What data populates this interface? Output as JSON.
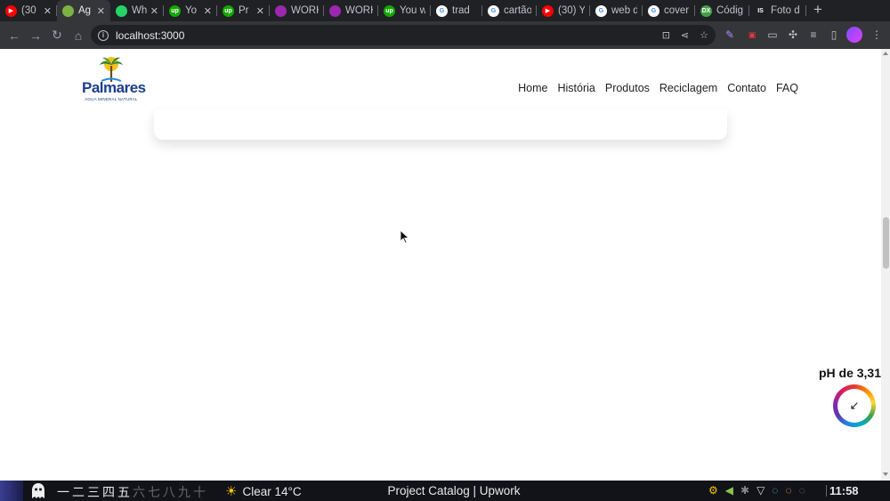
{
  "browser": {
    "tabs": [
      {
        "title": "(30",
        "favicon": "youtube-icon",
        "color": "#ff0000",
        "glyph": "▶",
        "width": 64
      },
      {
        "title": "Ag",
        "favicon": "palm-favicon-icon",
        "color": "#7cb342",
        "glyph": "",
        "width": 60,
        "active": true
      },
      {
        "title": "Wh",
        "favicon": "whatsapp-icon",
        "color": "#25d366",
        "glyph": "",
        "width": 60
      },
      {
        "title": "Yo",
        "favicon": "upwork-icon",
        "color": "#14a800",
        "glyph": "up",
        "width": 60
      },
      {
        "title": "Pr",
        "favicon": "upwork-icon",
        "color": "#14a800",
        "glyph": "up",
        "width": 59
      },
      {
        "title": "WORK",
        "favicon": "color-wheel-icon",
        "color": "#9c27b0",
        "glyph": "",
        "width": 61
      },
      {
        "title": "WORK",
        "favicon": "color-wheel-icon",
        "color": "#9c27b0",
        "glyph": "",
        "width": 61
      },
      {
        "title": "You w",
        "favicon": "upwork-icon",
        "color": "#14a800",
        "glyph": "up",
        "width": 59
      },
      {
        "title": "trad",
        "favicon": "google-icon",
        "color": "#ffffff",
        "glyph": "G",
        "width": 58
      },
      {
        "title": "cartão",
        "favicon": "google-icon",
        "color": "#ffffff",
        "glyph": "G",
        "width": 61
      },
      {
        "title": "(30) Y",
        "favicon": "youtube-icon",
        "color": "#ff0000",
        "glyph": "▶",
        "width": 60
      },
      {
        "title": "web d",
        "favicon": "google-icon",
        "color": "#ffffff",
        "glyph": "G",
        "width": 59
      },
      {
        "title": "cover",
        "favicon": "google-icon",
        "color": "#ffffff",
        "glyph": "G",
        "width": 59
      },
      {
        "title": "Códig",
        "favicon": "dx-icon",
        "color": "#43a047",
        "glyph": "DX",
        "width": 61
      },
      {
        "title": "Foto d",
        "favicon": "is-icon",
        "color": "#202124",
        "glyph": "IS",
        "width": 64
      }
    ],
    "url": "localhost:3000"
  },
  "site": {
    "logo_text": "Palmares",
    "logo_tagline": "ÁGUA MINERAL NATURAL",
    "nav": [
      "Home",
      "História",
      "Produtos",
      "Reciclagem",
      "Contato",
      "FAQ"
    ],
    "ph_label": "pH de 3,31",
    "ph_icon": "arrow-down-left-icon"
  },
  "taskbar": {
    "workspaces": [
      "一",
      "二",
      "三",
      "四",
      "五",
      "六",
      "七",
      "八",
      "九",
      "十"
    ],
    "active_workspaces": 5,
    "weather": "Clear 14°C",
    "window_title": "Project Catalog | Upwork",
    "clock": "11:58"
  }
}
